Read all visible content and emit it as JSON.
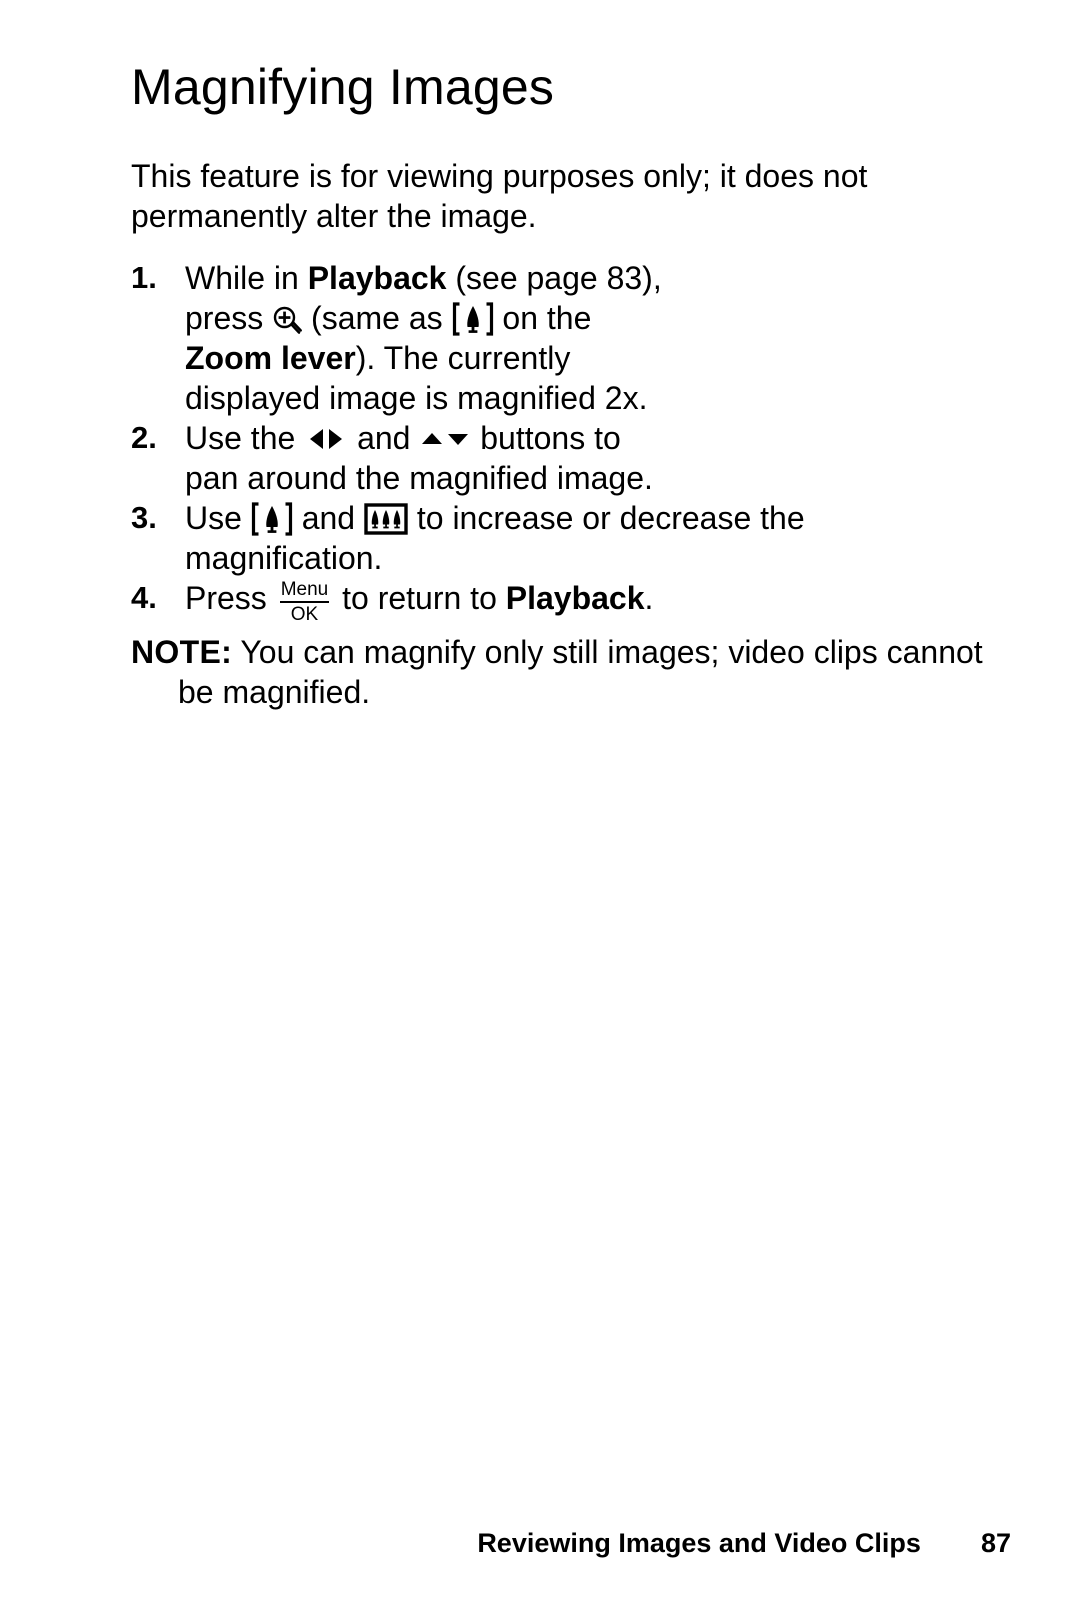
{
  "document": {
    "title": "Magnifying Images",
    "intro": "This feature is for viewing purposes only; it does not permanently alter the image."
  },
  "steps": [
    {
      "number": "1.",
      "text_part1": "While in ",
      "bold1": "Playback",
      "text_part2": " (see page 83), press ",
      "icon1": "magnifier-plus-icon",
      "text_part3": " (same as ",
      "icon2": "telephoto-tree-icon",
      "text_part4": " on the ",
      "bold2": "Zoom lever",
      "text_part5": "). The currently displayed image is magnified 2x."
    },
    {
      "number": "2.",
      "text_part1": "Use the ",
      "icon1": "left-right-arrows-icon",
      "text_part2": " and ",
      "icon2": "up-down-arrows-icon",
      "text_part3": " buttons to pan around the magnified image."
    },
    {
      "number": "3.",
      "text_part1": "Use ",
      "icon1": "telephoto-tree-icon",
      "text_part2": " and ",
      "icon2": "wide-angle-trees-icon",
      "text_part3": " to increase or decrease the magnification."
    },
    {
      "number": "4.",
      "text_part1": "Press ",
      "icon1": "menu-ok-button-icon",
      "icon1_top": "Menu",
      "icon1_bottom": "OK",
      "text_part2": " to return to ",
      "bold1": "Playback",
      "text_part3": "."
    }
  ],
  "note": {
    "label": "NOTE:",
    "line1": "You can magnify only still images; video clips cannot",
    "line2": "be magnified."
  },
  "footer": {
    "title": "Reviewing Images and Video Clips",
    "page_number": "87"
  },
  "colors": {
    "text": "#000000",
    "background": "#ffffff"
  }
}
